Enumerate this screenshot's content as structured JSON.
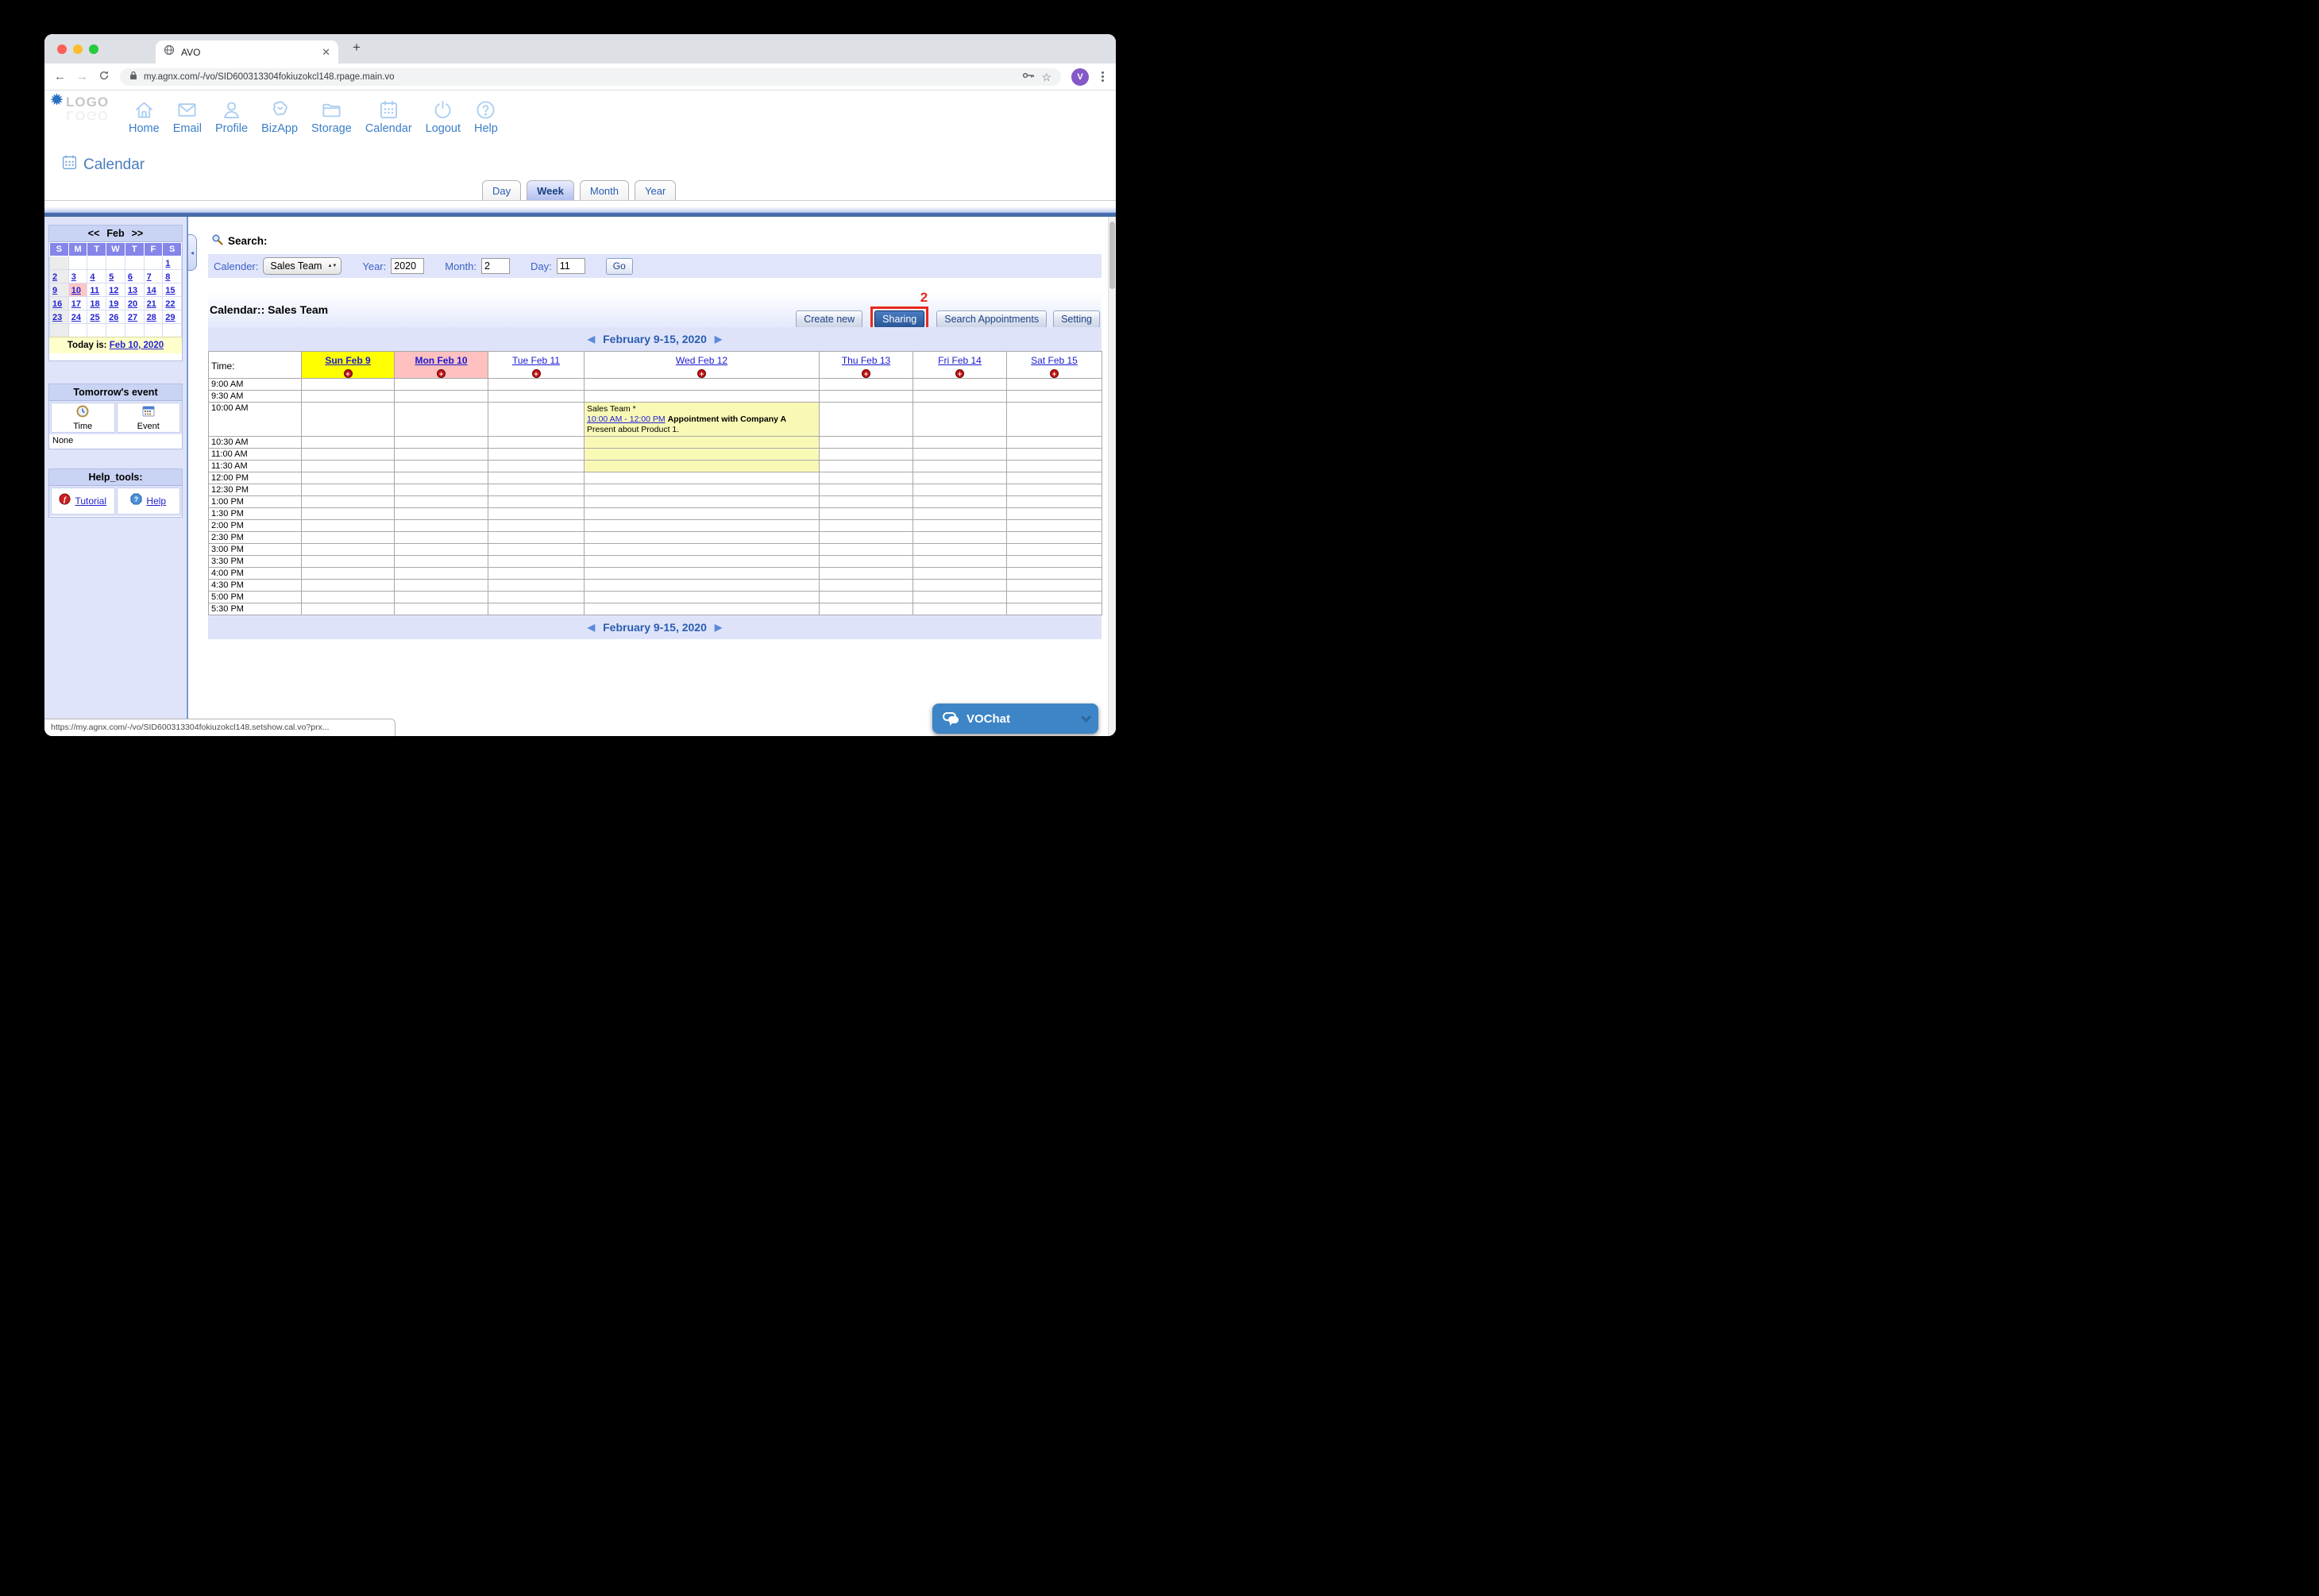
{
  "browser": {
    "tab_title": "AVO",
    "url": "my.agnx.com/-/vo/SID600313304fokiuzokcl148.rpage.main.vo",
    "status_url": "https://my.agnx.com/-/vo/SID600313304fokiuzokcl148.setshow.cal.vo?prx...",
    "avatar_initial": "V",
    "avatar_color": "#8458c8"
  },
  "nav": {
    "logo": "LOGO",
    "items": [
      {
        "label": "Home",
        "icon": "home"
      },
      {
        "label": "Email",
        "icon": "email"
      },
      {
        "label": "Profile",
        "icon": "profile"
      },
      {
        "label": "BizApp",
        "icon": "bizapp"
      },
      {
        "label": "Storage",
        "icon": "storage"
      },
      {
        "label": "Calendar",
        "icon": "calendar"
      },
      {
        "label": "Logout",
        "icon": "logout"
      },
      {
        "label": "Help",
        "icon": "help"
      }
    ]
  },
  "page": {
    "title": "Calendar",
    "view_tabs": [
      {
        "label": "Day",
        "active": false
      },
      {
        "label": "Week",
        "active": true
      },
      {
        "label": "Month",
        "active": false
      },
      {
        "label": "Year",
        "active": false
      }
    ]
  },
  "sidebar": {
    "minical": {
      "prev": "<<",
      "month": "Feb",
      "next": ">>",
      "dow": [
        "S",
        "M",
        "T",
        "W",
        "T",
        "F",
        "S"
      ],
      "weeks": [
        [
          "",
          "",
          "",
          "",
          "",
          "",
          "1"
        ],
        [
          "2",
          "3",
          "4",
          "5",
          "6",
          "7",
          "8"
        ],
        [
          "9",
          "10",
          "11",
          "12",
          "13",
          "14",
          "15"
        ],
        [
          "16",
          "17",
          "18",
          "19",
          "20",
          "21",
          "22"
        ],
        [
          "23",
          "24",
          "25",
          "26",
          "27",
          "28",
          "29"
        ],
        [
          "",
          "",
          "",
          "",
          "",
          "",
          ""
        ]
      ],
      "today_cell": "10",
      "today_label": "Today is:",
      "today_date": "Feb 10, 2020"
    },
    "tomorrow": {
      "title": "Tomorrow's event",
      "cols": [
        {
          "label": "Time",
          "icon": "clock"
        },
        {
          "label": "Event",
          "icon": "event"
        }
      ],
      "value": "None"
    },
    "help_tools": {
      "title": "Help_tools:",
      "links": [
        {
          "label": "Tutorial",
          "icon": "tutorial"
        },
        {
          "label": "Help",
          "icon": "helptool"
        }
      ]
    }
  },
  "search": {
    "heading": "Search:",
    "calendar_label": "Calender:",
    "calendar_value": "Sales Team",
    "year_label": "Year:",
    "year_value": "2020",
    "month_label": "Month:",
    "month_value": "2",
    "day_label": "Day:",
    "day_value": "11",
    "go_label": "Go"
  },
  "toolbar": {
    "heading": "Calendar:: Sales Team",
    "buttons": [
      {
        "label": "Create new"
      },
      {
        "label": "Sharing",
        "active": true,
        "annotated": true
      },
      {
        "label": "Search Appointments"
      },
      {
        "label": "Setting"
      }
    ],
    "annotation": "2",
    "annotation_color": "#e8281e"
  },
  "week": {
    "nav_title": "February 9-15, 2020",
    "time_header": "Time:",
    "days": [
      {
        "label": "Sun Feb 9",
        "bg": "#ffff00",
        "bold": true
      },
      {
        "label": "Mon Feb 10",
        "bg": "#ffc0c0",
        "bold": true
      },
      {
        "label": "Tue Feb 11",
        "bg": "#ffffff",
        "bold": false
      },
      {
        "label": "Wed Feb 12",
        "bg": "#ffffff",
        "bold": false
      },
      {
        "label": "Thu Feb 13",
        "bg": "#ffffff",
        "bold": false
      },
      {
        "label": "Fri Feb 14",
        "bg": "#ffffff",
        "bold": false
      },
      {
        "label": "Sat Feb 15",
        "bg": "#ffffff",
        "bold": false
      }
    ],
    "times": [
      "9:00 AM",
      "9:30 AM",
      "10:00 AM",
      "10:30 AM",
      "11:00 AM",
      "11:30 AM",
      "12:00 PM",
      "12:30 PM",
      "1:00 PM",
      "1:30 PM",
      "2:00 PM",
      "2:30 PM",
      "3:00 PM",
      "3:30 PM",
      "4:00 PM",
      "4:30 PM",
      "5:00 PM",
      "5:30 PM"
    ],
    "event": {
      "day": "Wed Feb 12",
      "day_index": 3,
      "start_time": "10:00 AM",
      "span_slots": 4,
      "owner": "Sales Team *",
      "time_range": "10:00 AM - 12:00 PM",
      "title": "Appointment with Company A",
      "description": "Present about Product 1.",
      "bg": "#f9f9b6"
    }
  },
  "vochat": {
    "label": "VOChat"
  }
}
